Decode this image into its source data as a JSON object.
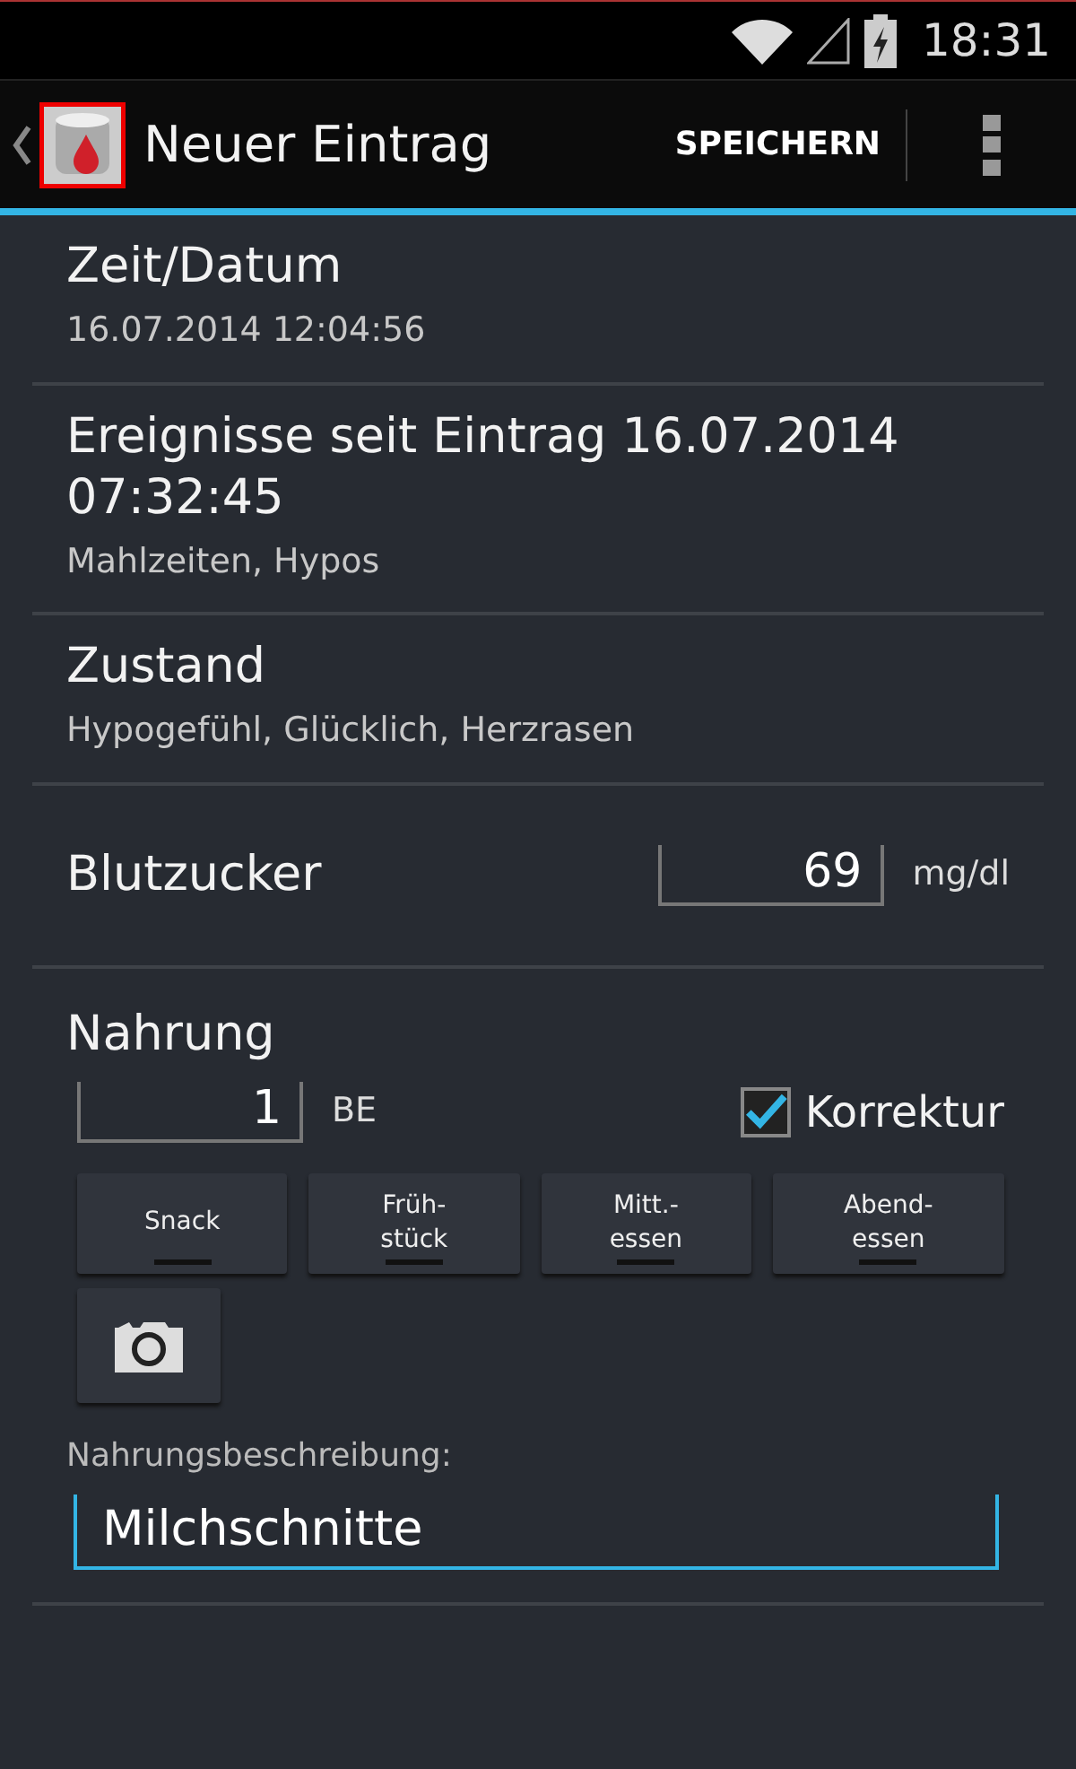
{
  "status_bar": {
    "time": "18:31"
  },
  "action_bar": {
    "title": "Neuer Eintrag",
    "save": "SPEICHERN"
  },
  "sections": [
    {
      "title": "Zeit/Datum",
      "subtitle": "16.07.2014 12:04:56"
    },
    {
      "title": "Ereignisse seit Eintrag 16.07.2014 07:32:45",
      "subtitle": "Mahlzeiten, Hypos"
    },
    {
      "title": "Zustand",
      "subtitle": "Hypogefühl, Glücklich, Herzrasen"
    }
  ],
  "blood_sugar": {
    "label": "Blutzucker",
    "value": "69",
    "unit": "mg/dl"
  },
  "food": {
    "title": "Nahrung",
    "amount": "1",
    "unit": "BE",
    "correction": {
      "label": "Korrektur",
      "checked": true
    },
    "meals": [
      {
        "label": "Snack",
        "selected": false
      },
      {
        "label": "Früh-\nstück",
        "selected": false
      },
      {
        "label": "Mitt.-\nessen",
        "selected": false
      },
      {
        "label": "Abend-\nessen",
        "selected": false
      }
    ],
    "description_label": "Nahrungsbeschreibung:",
    "description": "Milchschnitte"
  }
}
